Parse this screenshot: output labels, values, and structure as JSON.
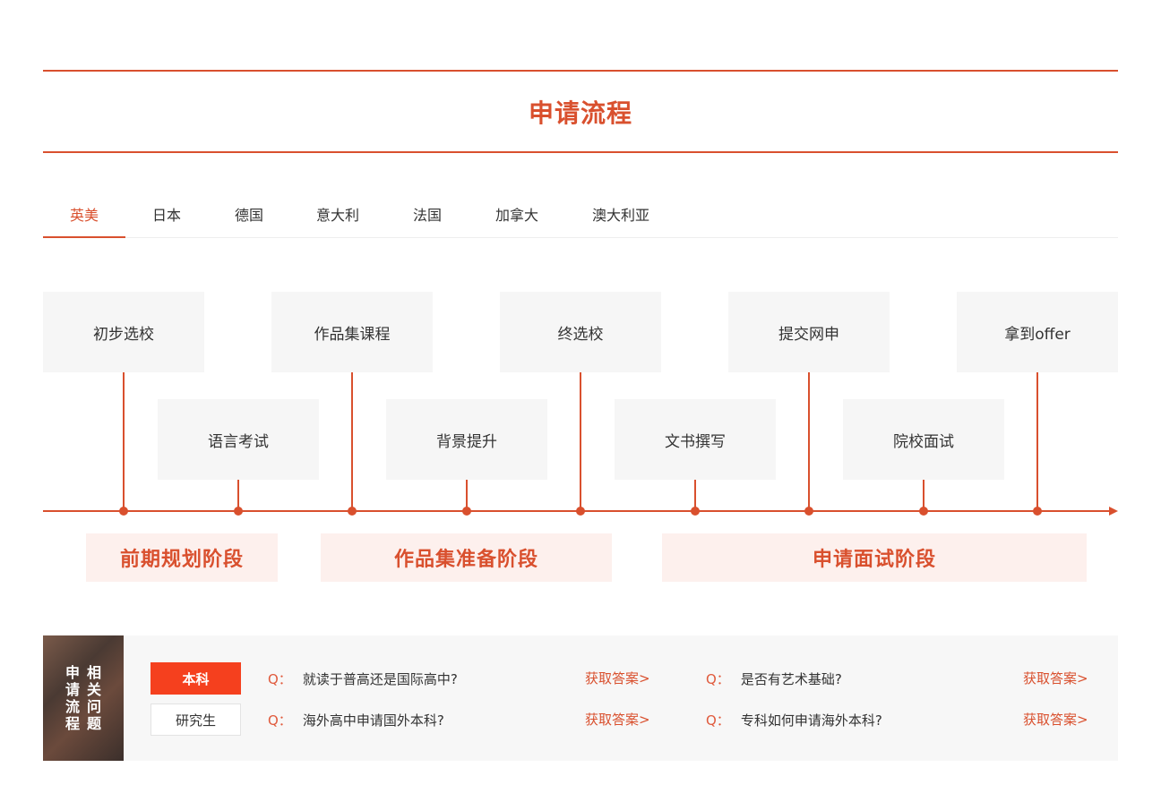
{
  "section_title": "申请流程",
  "tabs": [
    {
      "label": "英美"
    },
    {
      "label": "日本"
    },
    {
      "label": "德国"
    },
    {
      "label": "意大利"
    },
    {
      "label": "法国"
    },
    {
      "label": "加拿大"
    },
    {
      "label": "澳大利亚"
    }
  ],
  "timeline": {
    "upper_steps": [
      "初步选校",
      "作品集课程",
      "终选校",
      "提交网申",
      "拿到offer"
    ],
    "lower_steps": [
      "语言考试",
      "背景提升",
      "文书撰写",
      "院校面试"
    ]
  },
  "stages": [
    "前期规划阶段",
    "作品集准备阶段",
    "申请面试阶段"
  ],
  "faq": {
    "cover_text": [
      "相关问题",
      "申请流程"
    ],
    "levels": [
      "本科",
      "研究生"
    ],
    "q_prefix": "Q：",
    "answer_label": "获取答案>",
    "questions": [
      "就读于普高还是国际高中?",
      "是否有艺术基础?",
      "海外高中申请国外本科?",
      "专科如何申请海外本科?"
    ]
  },
  "colors": {
    "accent": "#d9502e",
    "button_red": "#f5401e",
    "box_bg": "#f6f6f6",
    "stage_bg": "#fdf0ed"
  }
}
